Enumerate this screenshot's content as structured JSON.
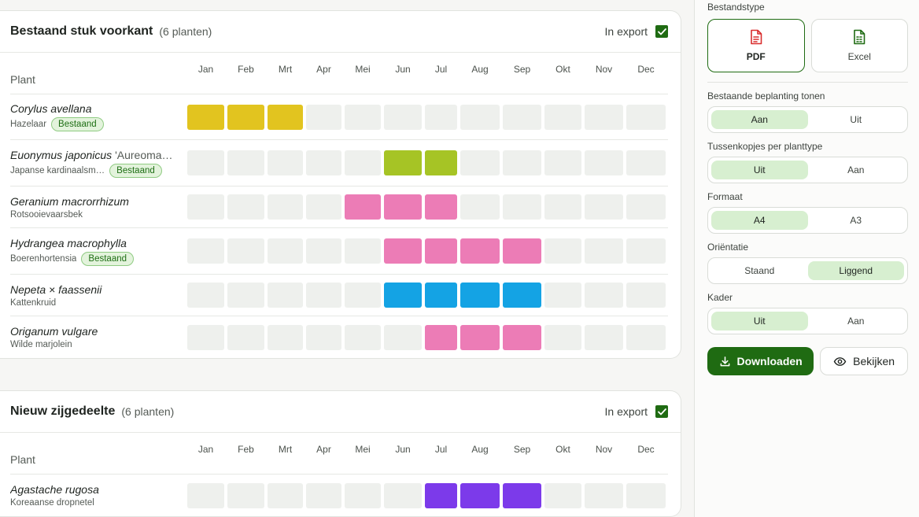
{
  "months": [
    "Jan",
    "Feb",
    "Mrt",
    "Apr",
    "Mei",
    "Jun",
    "Jul",
    "Aug",
    "Sep",
    "Okt",
    "Nov",
    "Dec"
  ],
  "sections": [
    {
      "title": "Bestaand stuk voorkant",
      "count": "(6 planten)",
      "export_label": "In export",
      "export_checked": true,
      "col_plant": "Plant",
      "plants": [
        {
          "latin": "Corylus avellana",
          "cultivar": "",
          "common": "Hazelaar",
          "badge": "Bestaand",
          "color": "#e2c41f",
          "bloom": [
            1,
            2,
            3
          ]
        },
        {
          "latin": "Euonymus japonicus",
          "cultivar": "'Aureoma…",
          "common": "Japanse kardinaalsm…",
          "badge": "Bestaand",
          "color": "#a6c425",
          "bloom": [
            6,
            7
          ]
        },
        {
          "latin": "Geranium macrorrhizum",
          "cultivar": "",
          "common": "Rotsooievaarsbek",
          "badge": "",
          "color": "#ec7cb6",
          "bloom": [
            5,
            6,
            7
          ]
        },
        {
          "latin": "Hydrangea macrophylla",
          "cultivar": "",
          "common": "Boerenhortensia",
          "badge": "Bestaand",
          "color": "#ec7cb6",
          "bloom": [
            6,
            7,
            8,
            9
          ]
        },
        {
          "latin": "Nepeta × faassenii",
          "cultivar": "",
          "common": "Kattenkruid",
          "badge": "",
          "color": "#14a3e4",
          "bloom": [
            6,
            7,
            8,
            9
          ]
        },
        {
          "latin": "Origanum vulgare",
          "cultivar": "",
          "common": "Wilde marjolein",
          "badge": "",
          "color": "#ec7cb6",
          "bloom": [
            7,
            8,
            9
          ]
        }
      ]
    },
    {
      "title": "Nieuw zijgedeelte",
      "count": "(6 planten)",
      "export_label": "In export",
      "export_checked": true,
      "col_plant": "Plant",
      "plants": [
        {
          "latin": "Agastache rugosa",
          "cultivar": "",
          "common": "Koreaanse dropnetel",
          "badge": "",
          "color": "#7c3aea",
          "bloom": [
            7,
            8,
            9
          ]
        }
      ]
    }
  ],
  "sidebar": {
    "filetype_label": "Bestandstype",
    "filetypes": [
      {
        "name": "PDF",
        "icon": "pdf-file-icon",
        "icon_color": "#d92d2d",
        "active": true
      },
      {
        "name": "Excel",
        "icon": "spreadsheet-file-icon",
        "icon_color": "#1f6b12",
        "active": false
      }
    ],
    "options": [
      {
        "label": "Bestaande beplanting tonen",
        "choices": [
          "Aan",
          "Uit"
        ],
        "selected": 0
      },
      {
        "label": "Tussenkopjes per planttype",
        "choices": [
          "Uit",
          "Aan"
        ],
        "selected": 0
      },
      {
        "label": "Formaat",
        "choices": [
          "A4",
          "A3"
        ],
        "selected": 0
      },
      {
        "label": "Oriëntatie",
        "choices": [
          "Staand",
          "Liggend"
        ],
        "selected": 1
      },
      {
        "label": "Kader",
        "choices": [
          "Uit",
          "Aan"
        ],
        "selected": 0
      }
    ],
    "download_label": "Downloaden",
    "view_label": "Bekijken"
  },
  "colors": {
    "accent": "#1f6b12",
    "empty_cell": "#eef0ed",
    "badge_bg": "#e3f3dc",
    "toggle_on": "#d7efd0"
  }
}
